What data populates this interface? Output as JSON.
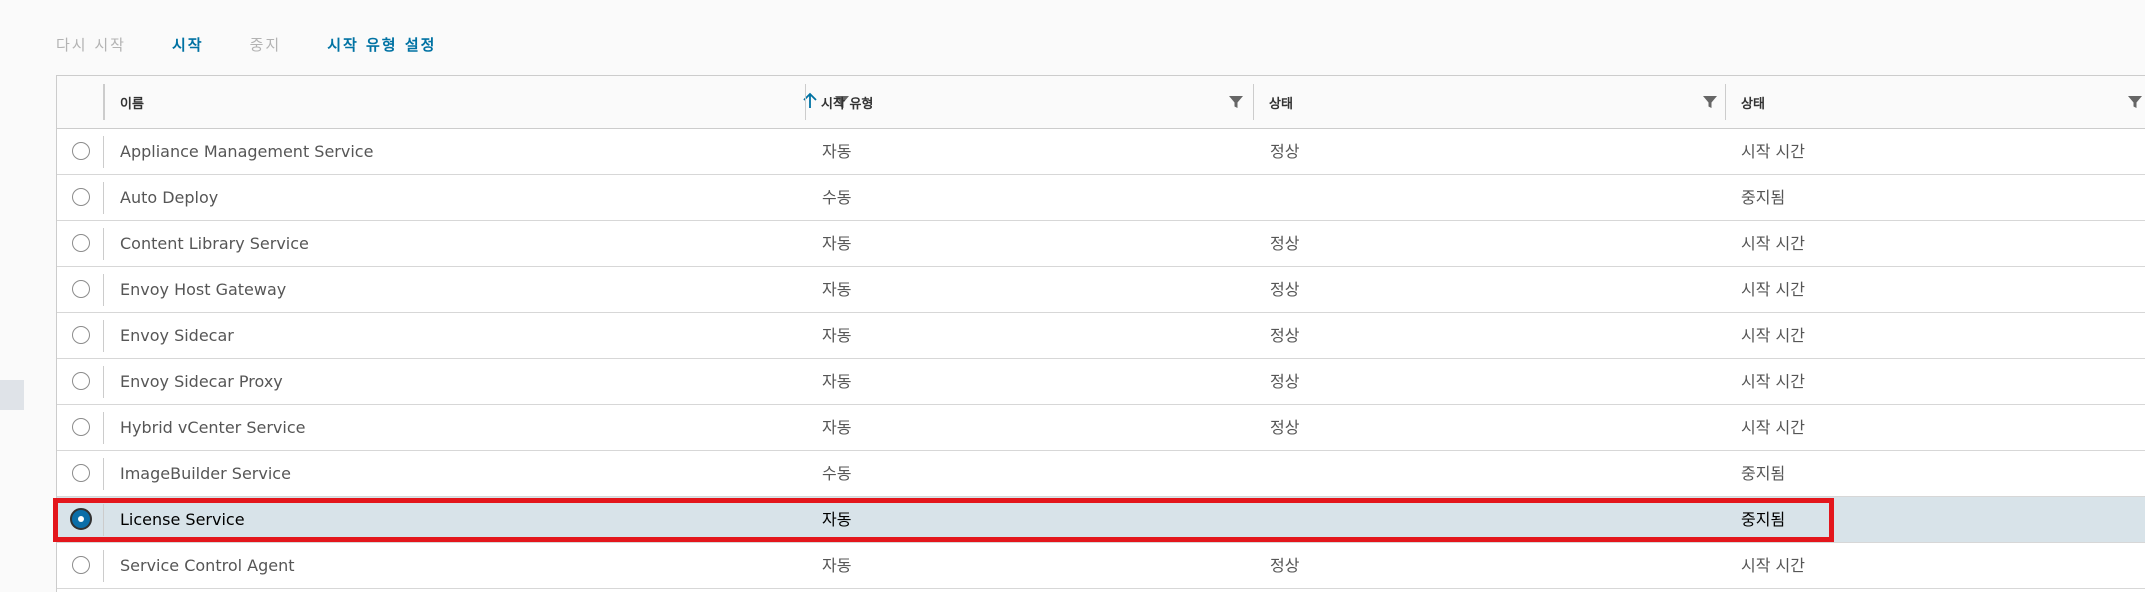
{
  "toolbar": {
    "restart_label": "다시 시작",
    "start_label": "시작",
    "stop_label": "중지",
    "set_startup_type_label": "시작 유형 설정"
  },
  "table": {
    "columns": [
      {
        "label": "이름",
        "sort_icon": "arrow-up-icon",
        "filter_icon": "filter-icon"
      },
      {
        "label": "시작 유형",
        "filter_icon": "filter-icon"
      },
      {
        "label": "상태",
        "filter_icon": "filter-icon"
      },
      {
        "label": "상태",
        "filter_icon": "filter-icon"
      }
    ],
    "rows": [
      {
        "name": "Appliance Management Service",
        "startup": "자동",
        "health": "정상",
        "state": "시작 시간",
        "selected": false
      },
      {
        "name": "Auto Deploy",
        "startup": "수동",
        "health": "",
        "state": "중지됨",
        "selected": false
      },
      {
        "name": "Content Library Service",
        "startup": "자동",
        "health": "정상",
        "state": "시작 시간",
        "selected": false
      },
      {
        "name": "Envoy Host Gateway",
        "startup": "자동",
        "health": "정상",
        "state": "시작 시간",
        "selected": false
      },
      {
        "name": "Envoy Sidecar",
        "startup": "자동",
        "health": "정상",
        "state": "시작 시간",
        "selected": false
      },
      {
        "name": "Envoy Sidecar Proxy",
        "startup": "자동",
        "health": "정상",
        "state": "시작 시간",
        "selected": false
      },
      {
        "name": "Hybrid vCenter Service",
        "startup": "자동",
        "health": "정상",
        "state": "시작 시간",
        "selected": false
      },
      {
        "name": "ImageBuilder Service",
        "startup": "수동",
        "health": "",
        "state": "중지됨",
        "selected": false
      },
      {
        "name": "License Service",
        "startup": "자동",
        "health": "",
        "state": "중지됨",
        "selected": true
      },
      {
        "name": "Service Control Agent",
        "startup": "자동",
        "health": "정상",
        "state": "시작 시간",
        "selected": false
      }
    ]
  },
  "colors": {
    "accent": "#0072a3",
    "disabled": "#b3b3b3",
    "selected_row": "#d8e3e9",
    "highlight_border": "#e3161c"
  }
}
